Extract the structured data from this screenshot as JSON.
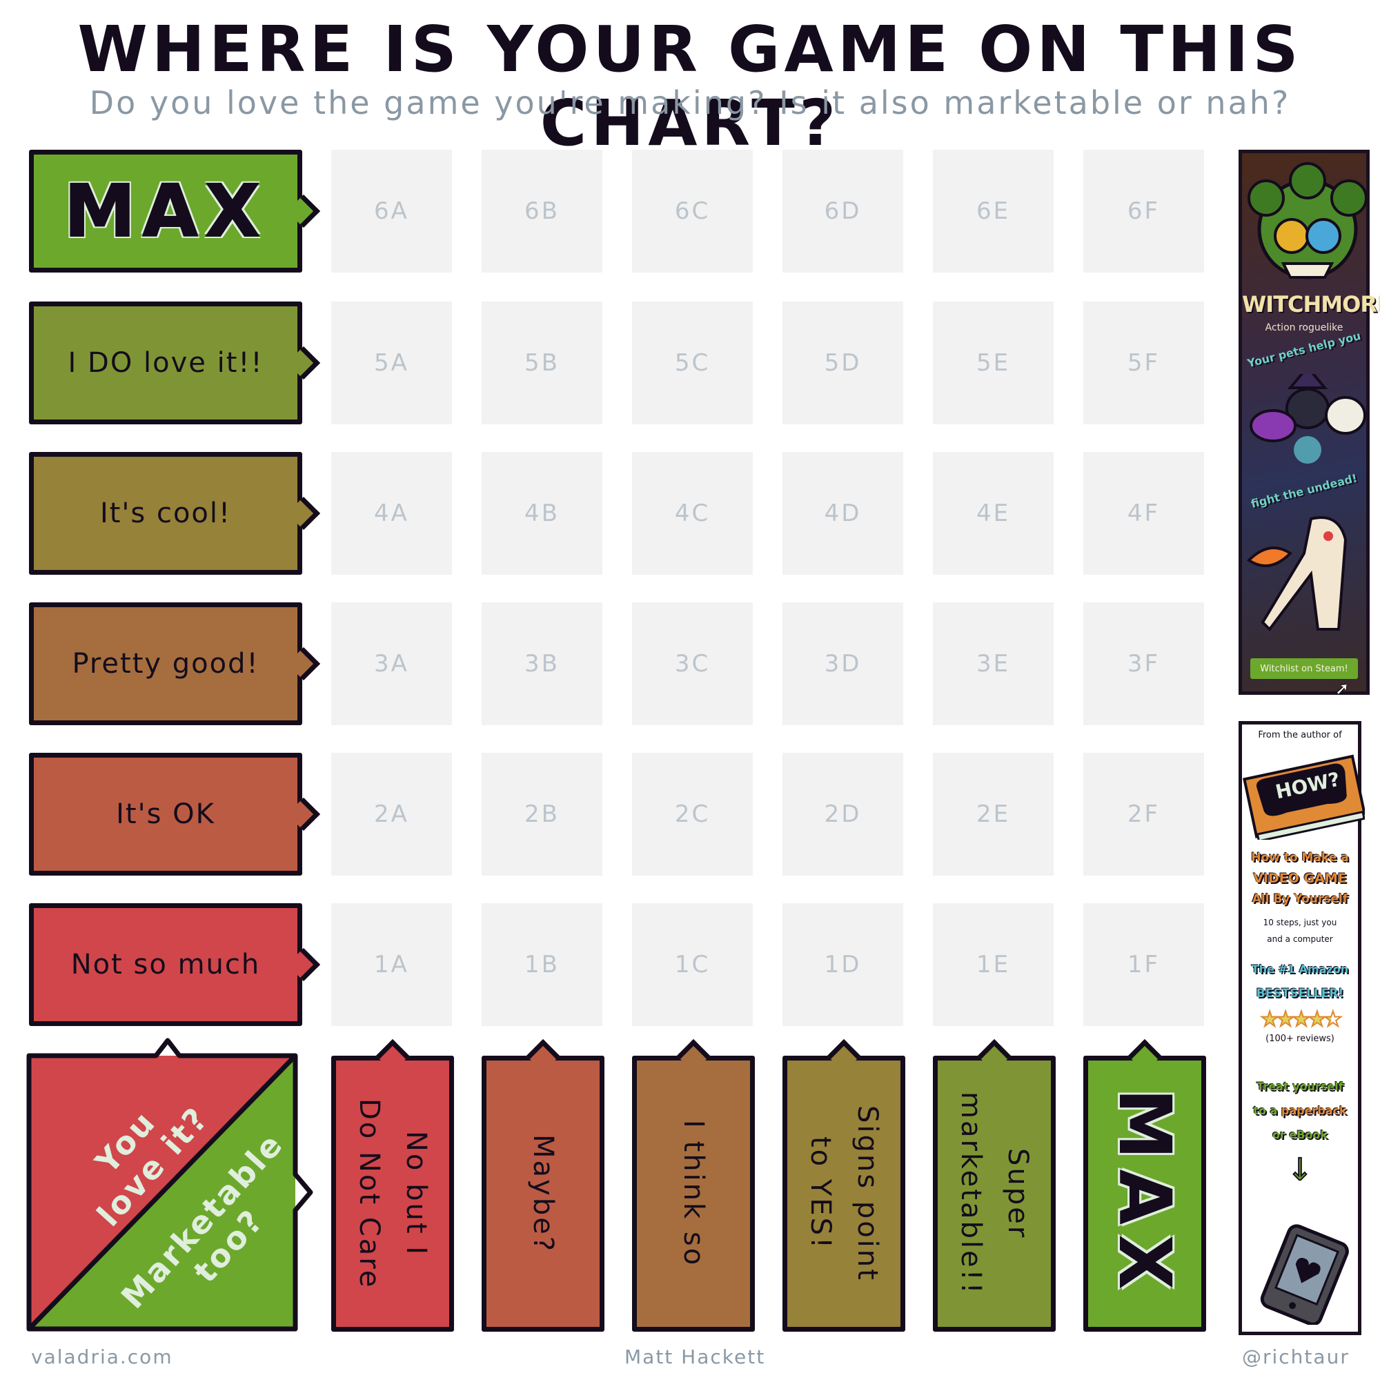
{
  "header": {
    "title": "WHERE IS YOUR GAME ON THIS CHART?",
    "subtitle": "Do you love the game you're making? Is it also marketable or nah?"
  },
  "colors": {
    "max_green": "#6ca82c",
    "olive_green": "#7f9535",
    "olive": "#968238",
    "tan": "#a66e3e",
    "rust": "#bb5b44",
    "red": "#d0464a",
    "cell_bg": "#f2f2f2",
    "cell_text": "#bcc4cc",
    "subtitle_gray": "#8a98a4",
    "outline": "#140c1c"
  },
  "rows": [
    {
      "label": "MAX",
      "level": 6,
      "color": "#6ca82c"
    },
    {
      "label": "I DO love it!!",
      "level": 5,
      "color": "#7f9535"
    },
    {
      "label": "It's cool!",
      "level": 4,
      "color": "#968238"
    },
    {
      "label": "Pretty good!",
      "level": 3,
      "color": "#a66e3e"
    },
    {
      "label": "It's OK",
      "level": 2,
      "color": "#bb5b44"
    },
    {
      "label": "Not so much",
      "level": 1,
      "color": "#d0464a"
    }
  ],
  "columns": [
    {
      "label": "No but I\nDo Not Care",
      "letter": "A",
      "color": "#d0464a"
    },
    {
      "label": "Maybe?",
      "letter": "B",
      "color": "#bb5b44"
    },
    {
      "label": "I think so",
      "letter": "C",
      "color": "#a66e3e"
    },
    {
      "label": "Signs point\nto YES!",
      "letter": "D",
      "color": "#968238"
    },
    {
      "label": "Super\nmarketable!!",
      "letter": "E",
      "color": "#7f9535"
    },
    {
      "label": "MAX",
      "letter": "F",
      "color": "#6ca82c"
    }
  ],
  "grid": [
    [
      "6A",
      "6B",
      "6C",
      "6D",
      "6E",
      "6F"
    ],
    [
      "5A",
      "5B",
      "5C",
      "5D",
      "5E",
      "5F"
    ],
    [
      "4A",
      "4B",
      "4C",
      "4D",
      "4E",
      "4F"
    ],
    [
      "3A",
      "3B",
      "3C",
      "3D",
      "3E",
      "3F"
    ],
    [
      "2A",
      "2B",
      "2C",
      "2D",
      "2E",
      "2F"
    ],
    [
      "1A",
      "1B",
      "1C",
      "1D",
      "1E",
      "1F"
    ]
  ],
  "corner": {
    "top_text": "You\nlove it?",
    "bottom_text": "Marketable\ntoo?"
  },
  "ads": {
    "game": {
      "title": "WITCHMORE",
      "genre": "Action roguelike",
      "tagline1": "Your pets help you",
      "tagline2": "fight the undead!",
      "button": "Witchlist on Steam!"
    },
    "book": {
      "intro": "From the author of",
      "cover_text": "HOW?",
      "title_line1": "How to Make a",
      "title_line2": "VIDEO GAME",
      "title_line3": "All By Yourself",
      "desc_line1": "10 steps, just you",
      "desc_line2": "and a computer",
      "badge_line1": "The #1 Amazon",
      "badge_line2": "BESTSELLER!",
      "rating": 4.5,
      "rating_max": 5,
      "reviews": "(100+ reviews)",
      "cta_line1": "Treat yourself",
      "cta_line2a": "to a ",
      "cta_line2b": "paperback",
      "cta_line3": "or eBook"
    }
  },
  "footer": {
    "left": "valadria.com",
    "center": "Matt Hackett",
    "right": "@richtaur"
  }
}
